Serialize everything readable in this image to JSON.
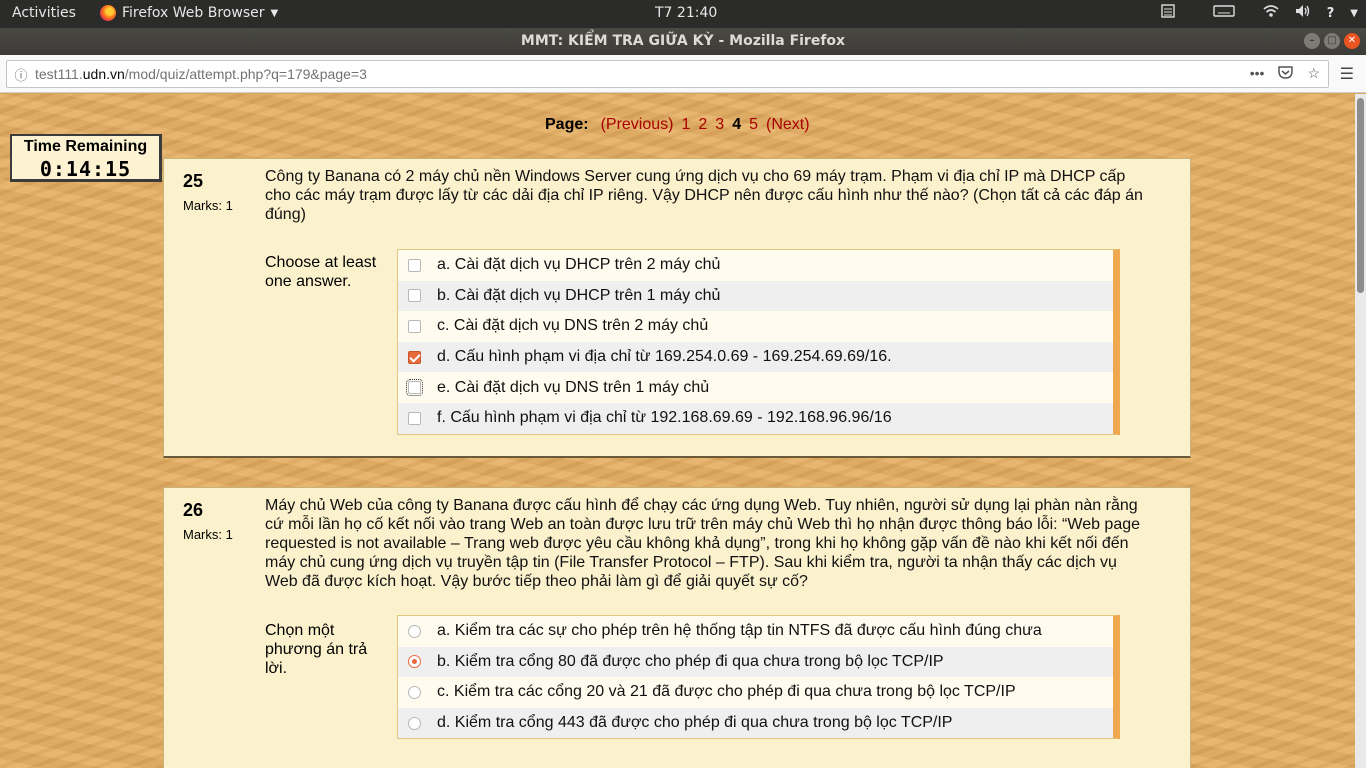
{
  "system": {
    "activities": "Activities",
    "app_name": "Firefox Web Browser",
    "clock": "T7 21:40"
  },
  "window": {
    "title": "MMT: KIỂM TRA GIỮA KỲ - Mozilla Firefox"
  },
  "urlbar": {
    "prefix": "test111.",
    "domain": "udn.vn",
    "path": "/mod/quiz/attempt.php?q=179&page=3"
  },
  "pager": {
    "label": "Page:",
    "previous": "(Previous)",
    "pages": [
      "1",
      "2",
      "3",
      "4",
      "5"
    ],
    "current": "4",
    "next": "(Next)"
  },
  "timer": {
    "label": "Time Remaining",
    "value": "0:14:15"
  },
  "questions": [
    {
      "number": "25",
      "marks": "Marks: 1",
      "text": "Công ty Banana có 2 máy chủ nền Windows Server cung ứng dịch vụ cho 69 máy trạm. Phạm vi địa chỉ IP mà DHCP cấp cho các máy trạm được lấy từ các dải địa chỉ IP riêng. Vậy DHCP nên được cấu hình như thế nào? (Chọn tất cả các đáp án đúng)",
      "prompt": "Choose at least one answer.",
      "type": "checkbox",
      "options": [
        {
          "label": "a. Cài đặt dịch vụ DHCP trên 2 máy chủ",
          "selected": false
        },
        {
          "label": "b. Cài đặt dịch vụ DHCP trên 1 máy chủ",
          "selected": false
        },
        {
          "label": "c. Cài đặt dịch vụ DNS trên 2 máy chủ",
          "selected": false
        },
        {
          "label": "d. Cấu hình phạm vi địa chỉ từ 169.254.0.69 - 169.254.69.69/16.",
          "selected": true
        },
        {
          "label": "e. Cài đặt dịch vụ DNS trên 1 máy chủ",
          "selected": false
        },
        {
          "label": "f. Cấu hình phạm vi địa chỉ từ 192.168.69.69 - 192.168.96.96/16",
          "selected": false
        }
      ]
    },
    {
      "number": "26",
      "marks": "Marks: 1",
      "text": "Máy chủ Web của công ty Banana được cấu hình để chạy các ứng dụng Web. Tuy nhiên, người sử dụng lại phàn nàn rằng cứ mỗi lần họ cố kết nối vào trang Web an toàn được lưu trữ trên máy chủ Web thì họ nhận được thông báo lỗi: “Web page requested is not available – Trang web được yêu cầu không khả dụng”, trong khi họ không gặp vấn đề nào khi kết nối đến máy chủ cung ứng dịch vụ truyền tập tin (File Transfer Protocol – FTP). Sau khi kiểm tra, người ta nhận thấy các dịch vụ Web đã được kích hoạt. Vậy bước tiếp theo phải làm gì để giải quyết sự cố?",
      "prompt": "Chọn một phương án trả lời.",
      "type": "radio",
      "options": [
        {
          "label": "a. Kiểm tra các sự cho phép trên hệ thống tập tin NTFS đã được cấu hình đúng chưa",
          "selected": false
        },
        {
          "label": "b. Kiểm tra cổng 80 đã được cho phép đi qua chưa trong bộ lọc TCP/IP",
          "selected": true
        },
        {
          "label": "c. Kiểm tra các cổng 20 và 21 đã được cho phép đi qua chưa trong bộ lọc TCP/IP",
          "selected": false
        },
        {
          "label": "d. Kiểm tra cổng 443 đã được cho phép đi qua chưa trong bộ lọc TCP/IP",
          "selected": false
        }
      ]
    }
  ]
}
